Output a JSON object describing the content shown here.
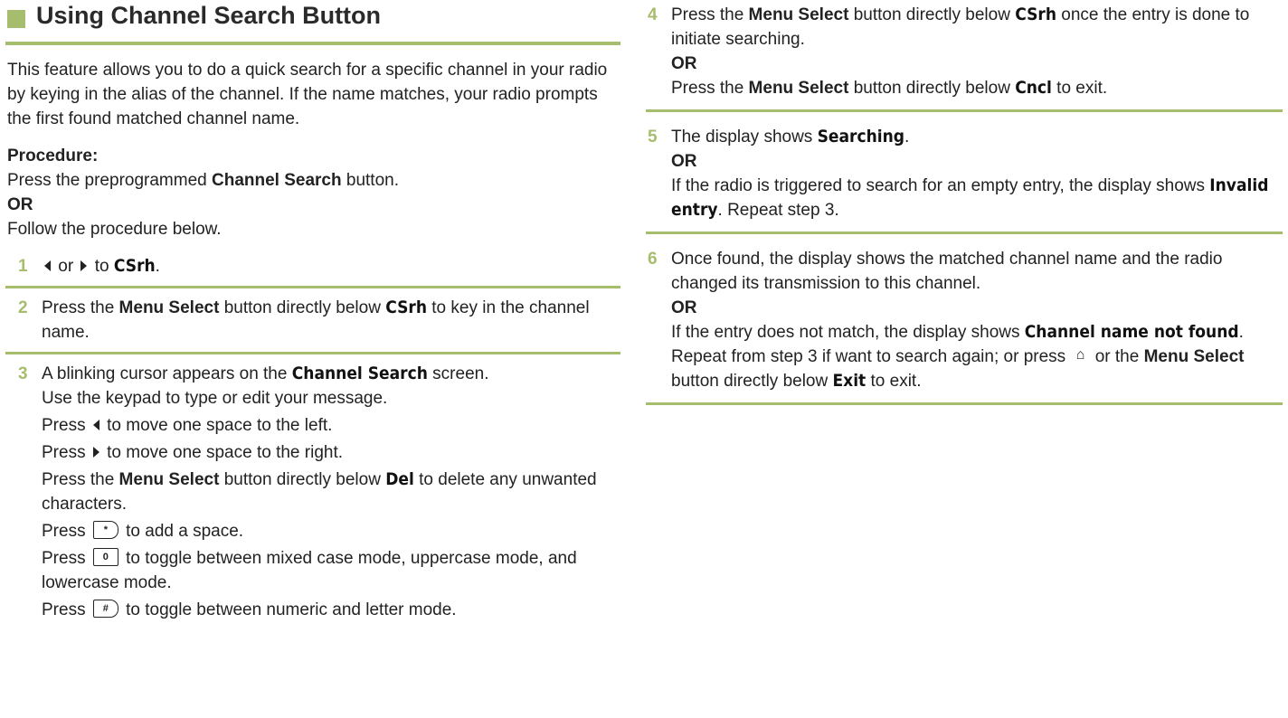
{
  "heading": "Using Channel Search Button",
  "intro": "This feature allows you to do a quick search for a specific channel in your radio by keying in the alias of the channel. If the name matches, your radio prompts the first found matched channel name.",
  "procedure_label": "Procedure:",
  "press_pre": "Press the preprogrammed ",
  "channel_search_bold": "Channel Search",
  "press_post": " button.",
  "or": "OR",
  "follow": "Follow the procedure below.",
  "steps": {
    "s1": {
      "num": "1",
      "a": " or ",
      "b": " to ",
      "lcd": "CSrh",
      "c": "."
    },
    "s2": {
      "num": "2",
      "a": "Press the ",
      "bold": "Menu Select",
      "b": " button directly below ",
      "lcd": "CSrh",
      "c": " to key in the channel name."
    },
    "s3": {
      "num": "3",
      "l1a": "A blinking cursor appears on the ",
      "l1lcd": "Channel Search",
      "l1b": " screen.",
      "l2": "Use the keypad to type or edit your message.",
      "l3a": "Press ",
      "l3b": " to move one space to the left.",
      "l4a": "Press ",
      "l4b": " to move one space to the right.",
      "l5a": "Press the ",
      "l5bold": "Menu Select",
      "l5b": " button directly below ",
      "l5lcd": "Del",
      "l5c": " to delete any unwanted characters.",
      "l6a": "Press ",
      "l6b": " to add a space.",
      "l7a": "Press ",
      "l7b": " to toggle between mixed case mode, uppercase mode, and lowercase mode.",
      "l8a": "Press ",
      "l8b": " to toggle between numeric and letter mode.",
      "key_star": "*",
      "key_zero": "0",
      "key_hash": "#"
    },
    "s4": {
      "num": "4",
      "a": "Press the ",
      "bold": "Menu Select",
      "b": " button directly below ",
      "lcd": "CSrh",
      "c": " once the entry is done to initiate searching.",
      "or": "OR",
      "d": "Press the ",
      "bold2": "Menu Select",
      "e": " button directly below ",
      "lcd2": "Cncl",
      "f": " to exit."
    },
    "s5": {
      "num": "5",
      "a": "The display shows ",
      "lcd": "Searching",
      "b": ".",
      "or": "OR",
      "c": "If the radio is triggered to search for an empty entry, the display shows ",
      "lcd2": "Invalid entry",
      "d": ". Repeat step 3."
    },
    "s6": {
      "num": "6",
      "a": "Once found, the display shows the matched channel name and the radio changed its transmission to this channel.",
      "or": "OR",
      "b": "If the entry does not match, the display shows ",
      "lcd": "Channel name not found",
      "c": ". Repeat from step 3 if want to search again; or press ",
      "d": " or the ",
      "bold": "Menu Select",
      "e": " button directly below ",
      "lcd2": "Exit",
      "f": " to exit."
    }
  },
  "icons": {
    "left_arrow": "left-arrow-icon",
    "right_arrow": "right-arrow-icon",
    "home": "home-icon",
    "star_key": "star-key-icon",
    "zero_key": "zero-key-icon",
    "hash_key": "hash-key-icon"
  },
  "colors": {
    "accent": "#a7bd6e"
  }
}
